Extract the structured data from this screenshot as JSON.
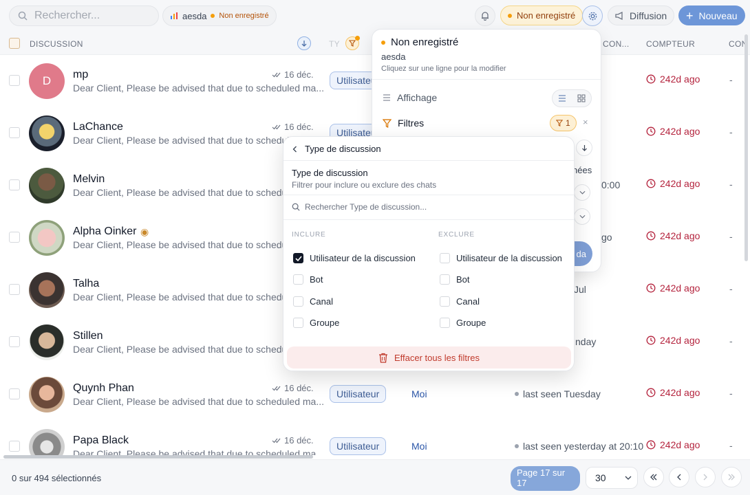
{
  "topbar": {
    "search_placeholder": "Rechercher...",
    "workspace_name": "aesda",
    "workspace_status": "Non enregistré",
    "status_label": "Non enregistré",
    "diffusion_label": "Diffusion",
    "new_label": "Nouveau"
  },
  "columns": {
    "discussion": "DISCUSSION",
    "type_short": "TY",
    "contact_short": "CON...",
    "counter": "COMPTEUR",
    "extra_short": "CON"
  },
  "rows": [
    {
      "name": "mp",
      "preview": "Dear Client, Please be advised that due to scheduled ma...",
      "date": "16 déc.",
      "type": "Utilisateur",
      "owner": "",
      "seen": "",
      "counter": "242d ago",
      "extra": "-",
      "initial": "D"
    },
    {
      "name": "LaChance",
      "preview": "Dear Client, Please be advised that due to schedule",
      "date": "16 déc.",
      "type": "Utilisateu",
      "owner": "",
      "seen": "",
      "counter": "242d ago",
      "extra": "-"
    },
    {
      "name": "Melvin",
      "preview": "Dear Client, Please be advised that due to schedule",
      "date": "",
      "type": "",
      "owner": "",
      "seen": "0:00",
      "counter": "242d ago",
      "extra": "-"
    },
    {
      "name": "Alpha Oinker",
      "preview": "Dear Client, Please be advised that due to schedule",
      "date": "",
      "type": "",
      "owner": "",
      "seen": "go",
      "counter": "242d ago",
      "extra": "-"
    },
    {
      "name": "Talha",
      "preview": "Dear Client, Please be advised that due to schedule",
      "date": "",
      "type": "",
      "owner": "",
      "seen": "Jul",
      "counter": "242d ago",
      "extra": "-"
    },
    {
      "name": "Stillen",
      "preview": "Dear Client, Please be advised that due to schedule",
      "date": "",
      "type": "",
      "owner": "",
      "seen": "nday",
      "counter": "242d ago",
      "extra": "-"
    },
    {
      "name": "Quynh Phan",
      "preview": "Dear Client, Please be advised that due to scheduled ma...",
      "date": "16 déc.",
      "type": "Utilisateur",
      "owner": "Moi",
      "seen": "last seen Tuesday",
      "counter": "242d ago",
      "extra": "-"
    },
    {
      "name": "Papa Black",
      "preview": "Dear Client, Please be advised that due to scheduled ma...",
      "date": "16 déc.",
      "type": "Utilisateur",
      "owner": "Moi",
      "seen": "last seen yesterday at 20:10",
      "counter": "242d ago",
      "extra": "-"
    }
  ],
  "footer": {
    "selected": "0 sur 494 sélectionnés",
    "page": "Page 17 sur 17",
    "per_page": "30"
  },
  "settings_panel": {
    "title": "Non enregistré",
    "workspace": "aesda",
    "hint": "Cliquez sur une ligne pour la modifier",
    "display_label": "Affichage",
    "filters_label": "Filtres",
    "filters_count": "1",
    "frag_nees": "nées",
    "frag_da": "da"
  },
  "filter_panel": {
    "back_label": "Type de discussion",
    "title": "Type de discussion",
    "subtitle": "Filtrer pour inclure ou exclure des chats",
    "search_placeholder": "Rechercher Type de discussion...",
    "include_label": "INCLURE",
    "exclude_label": "EXCLURE",
    "options": [
      "Utilisateur de la discussion",
      "Bot",
      "Canal",
      "Groupe"
    ],
    "include_checked": [
      true,
      false,
      false,
      false
    ],
    "clear_label": "Effacer tous les filtres"
  }
}
